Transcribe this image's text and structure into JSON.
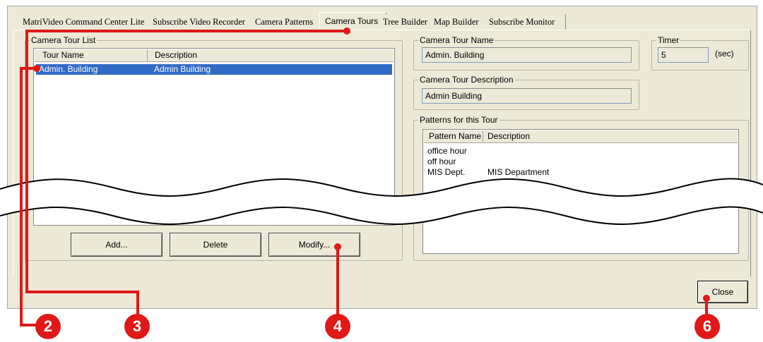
{
  "tabs": [
    {
      "label": "MatriVideo Command Center Lite"
    },
    {
      "label": "Subscribe Video Recorder"
    },
    {
      "label": "Camera Patterns"
    },
    {
      "label": "Camera Tours"
    },
    {
      "label": "Tree Builder"
    },
    {
      "label": "Map Builder"
    },
    {
      "label": "Subscribe Monitor"
    }
  ],
  "tour_list": {
    "group_label": "Camera Tour List",
    "columns": [
      "Tour Name",
      "Description"
    ],
    "rows": [
      {
        "name": "Admin. Building",
        "description": "Admin Building",
        "selected": true
      }
    ]
  },
  "buttons": {
    "add": "Add...",
    "delete": "Delete",
    "modify": "Modify...",
    "close": "Close"
  },
  "tour_name": {
    "label": "Camera Tour Name",
    "value": "Admin. Building"
  },
  "timer": {
    "label": "Timer",
    "value": "5",
    "unit": "(sec)"
  },
  "tour_description": {
    "label": "Camera Tour Description",
    "value": "Admin Building"
  },
  "patterns": {
    "group_label": "Patterns for this Tour",
    "columns": [
      "Pattern Name",
      "Description"
    ],
    "rows": [
      {
        "name": "office hour",
        "description": ""
      },
      {
        "name": "off hour",
        "description": ""
      },
      {
        "name": "MIS Dept.",
        "description": "MIS Department"
      }
    ]
  },
  "callouts": [
    "2",
    "3",
    "4",
    "6"
  ],
  "colors": {
    "callout": "#e01818",
    "selection": "#316ac5",
    "window_bg": "#ece9d8"
  }
}
